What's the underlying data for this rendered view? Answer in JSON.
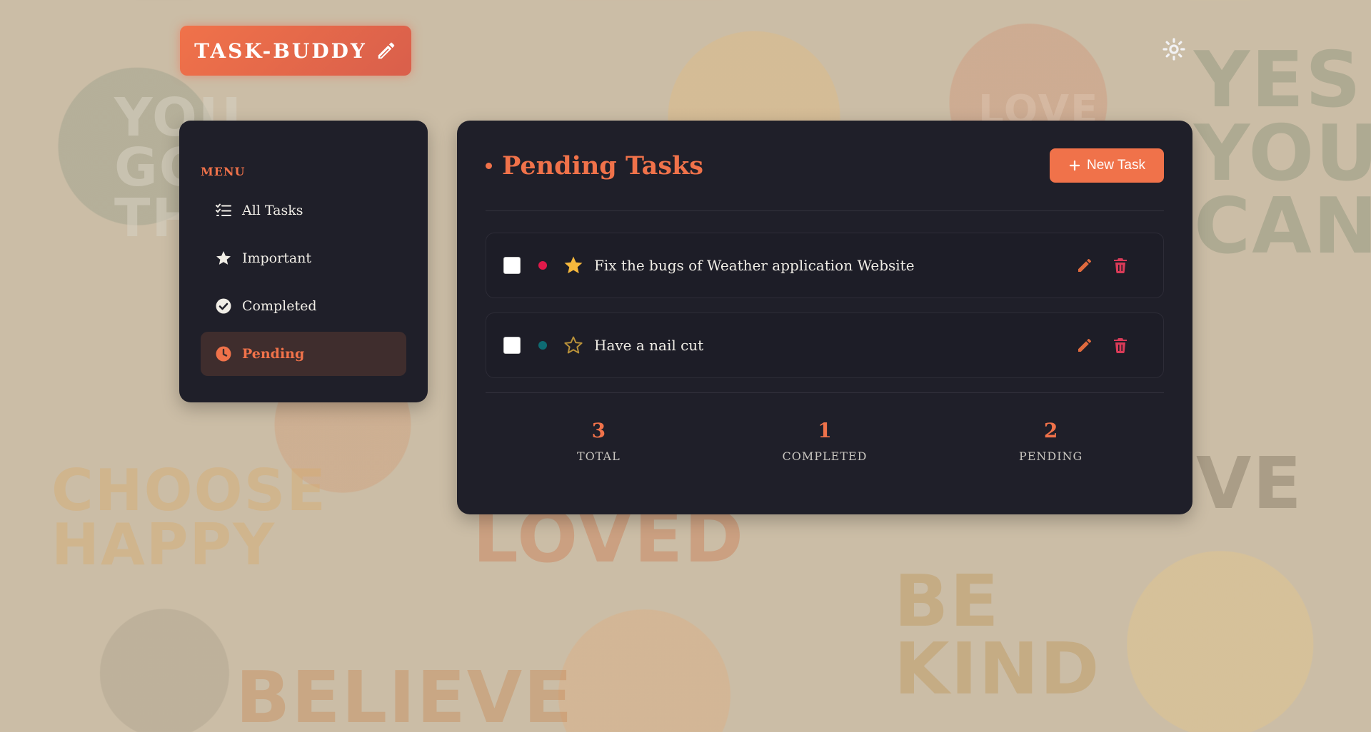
{
  "app": {
    "name": "TASK-BUDDY"
  },
  "background": {
    "words": [
      "YOU GOT THIS",
      "YES YOU CAN",
      "LOVE",
      "CHOOSE HAPPY",
      "LOVED",
      "BE KIND",
      "BELIEVE",
      "VE"
    ]
  },
  "sidebar": {
    "menu_title": "MENU",
    "items": [
      {
        "label": "All Tasks",
        "icon": "list-check-icon",
        "active": false
      },
      {
        "label": "Important",
        "icon": "star-icon",
        "active": false
      },
      {
        "label": "Completed",
        "icon": "check-circle-icon",
        "active": false
      },
      {
        "label": "Pending",
        "icon": "clock-icon",
        "active": true
      }
    ]
  },
  "main": {
    "title": "Pending Tasks",
    "new_task_label": "New Task",
    "tasks": [
      {
        "text": "Fix the bugs of Weather application Website",
        "priority_color": "#e0194a",
        "important": true,
        "checked": false
      },
      {
        "text": "Have a nail cut",
        "priority_color": "#0e6b72",
        "important": false,
        "checked": false
      }
    ],
    "stats": [
      {
        "value": "3",
        "label": "TOTAL"
      },
      {
        "value": "1",
        "label": "COMPLETED"
      },
      {
        "value": "2",
        "label": "PENDING"
      }
    ]
  },
  "colors": {
    "accent": "#f0724a",
    "panel": "#1f1f29",
    "active_item_bg": "#3f2d2d",
    "delete": "#d93b58",
    "star_filled": "#f6b83c"
  }
}
